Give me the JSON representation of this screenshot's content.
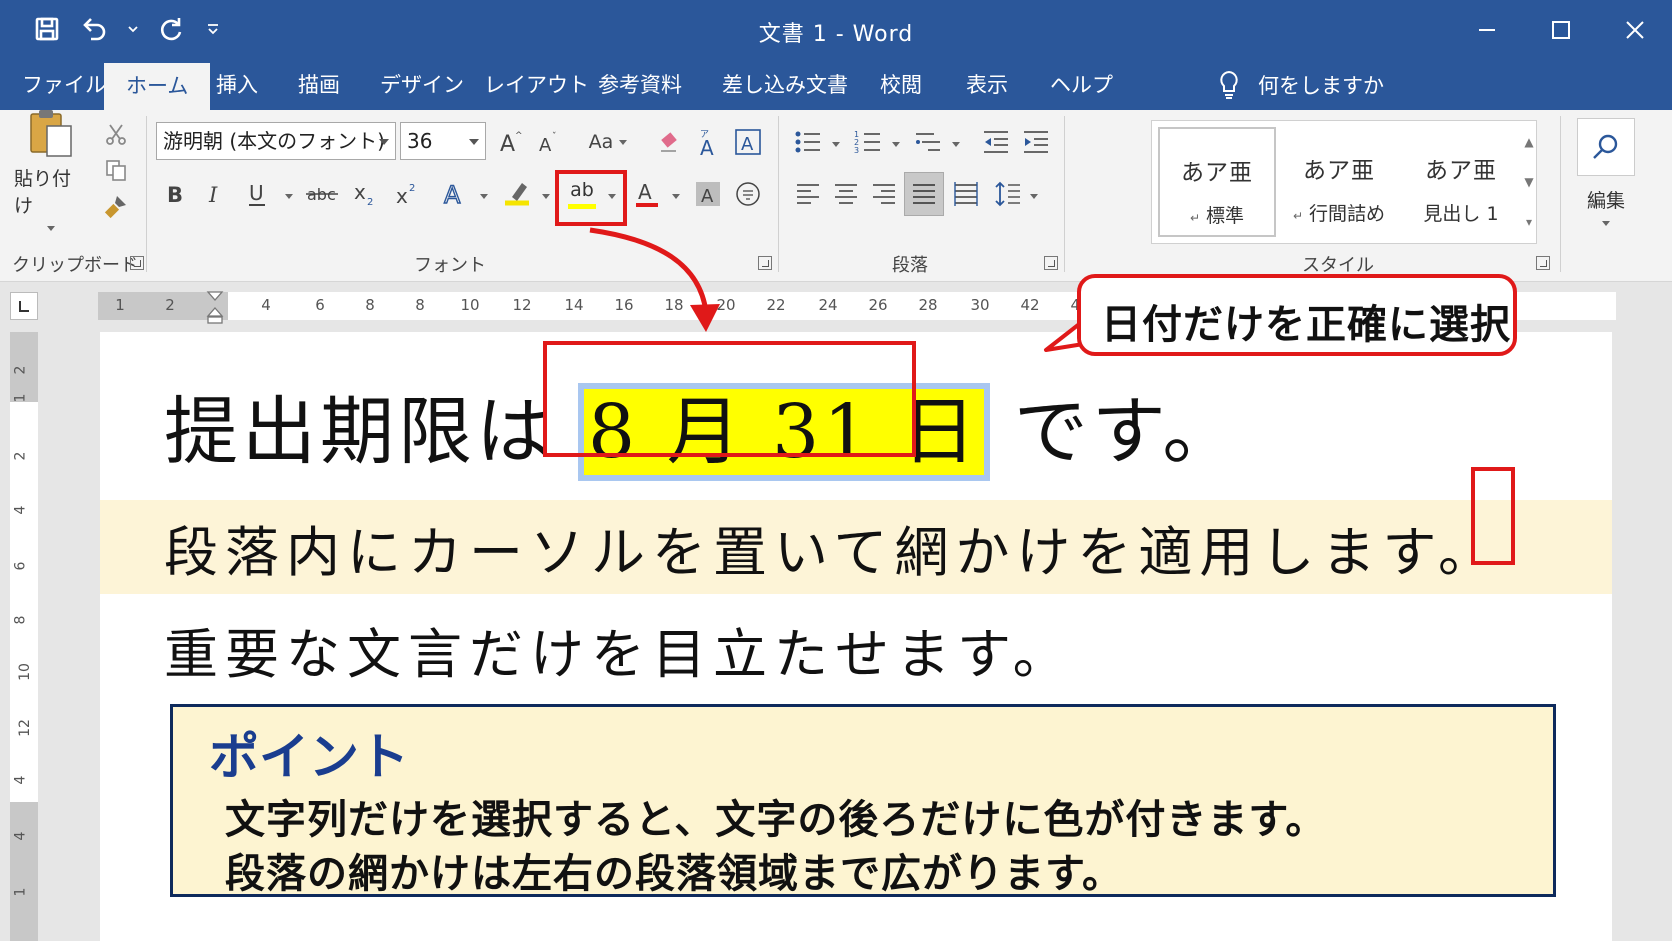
{
  "window": {
    "title": "文書 1  -  Word"
  },
  "qat": {
    "save": "save-icon",
    "undo": "undo-icon",
    "redo": "redo-icon",
    "customize": "customize-icon"
  },
  "tabs": [
    {
      "label": "ファイル"
    },
    {
      "label": "ホーム"
    },
    {
      "label": "挿入"
    },
    {
      "label": "描画"
    },
    {
      "label": "デザイン"
    },
    {
      "label": "レイアウト"
    },
    {
      "label": "参考資料"
    },
    {
      "label": "差し込み文書"
    },
    {
      "label": "校閲"
    },
    {
      "label": "表示"
    },
    {
      "label": "ヘルプ"
    }
  ],
  "tell_me": "何をしますか",
  "ribbon": {
    "clipboard": {
      "paste": "貼り付け",
      "label": "クリップボード"
    },
    "font": {
      "name": "游明朝 (本文のフォント)",
      "size": "36",
      "label": "フォント",
      "change_case": "Aa",
      "highlight_glyph": "ab"
    },
    "paragraph": {
      "label": "段落"
    },
    "styles": {
      "label": "スタイル",
      "items": [
        {
          "preview": "あア亜",
          "name": "標準"
        },
        {
          "preview": "あア亜",
          "name": "行間詰め"
        },
        {
          "preview": "あア亜",
          "name": "見出し 1"
        }
      ]
    },
    "editing": {
      "label": "編集"
    }
  },
  "ruler": {
    "h_ticks": [
      "1",
      "2",
      "4",
      "6",
      "8",
      "8",
      "10",
      "12",
      "14",
      "16",
      "18",
      "20",
      "22",
      "24",
      "26",
      "28",
      "30",
      "42",
      "40"
    ],
    "v_ticks": [
      "2",
      "1",
      "2",
      "4",
      "6",
      "8",
      "10",
      "12",
      "4",
      "4",
      "1"
    ]
  },
  "document": {
    "line1_before": "提出期限は",
    "line1_date": "8 月 31 日",
    "line1_after": "です。",
    "line2": "段落内にカーソルを置いて網かけを適用します。",
    "line3": "重要な文言だけを目立たせます。",
    "point": {
      "title": "ポイント",
      "line1": "文字列だけを選択すると、文字の後ろだけに色が付きます。",
      "line2": "段落の網かけは左右の段落領域まで広がります。"
    }
  },
  "callout": {
    "text": "日付だけを正確に選択"
  },
  "colors": {
    "accent": "#2b579a",
    "annotation": "#e01919",
    "highlight": "#ffff00",
    "shading": "#fdf4d7"
  }
}
